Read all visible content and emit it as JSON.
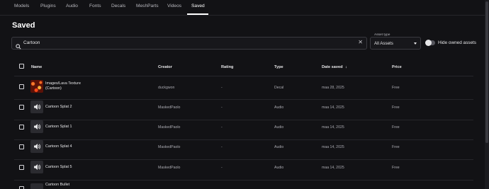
{
  "tabs": [
    {
      "label": "Models"
    },
    {
      "label": "Plugins"
    },
    {
      "label": "Audio"
    },
    {
      "label": "Fonts"
    },
    {
      "label": "Decals"
    },
    {
      "label": "MeshParts"
    },
    {
      "label": "Videos"
    },
    {
      "label": "Saved",
      "active": true
    }
  ],
  "page_title": "Saved",
  "search": {
    "value": "Cartoon"
  },
  "asset_type": {
    "label": "Asset type",
    "selected": "All Assets"
  },
  "hide_owned": {
    "label": "Hide owned assets",
    "on": false
  },
  "table": {
    "headers": {
      "name": "Name",
      "creator": "Creator",
      "rating": "Rating",
      "type": "Type",
      "date_saved": "Date saved",
      "price": "Price"
    },
    "sort_indicator": "↓",
    "rows": [
      {
        "name_line1": "Images/Lava Texture",
        "name_line2": "(Cartoon)",
        "creator": "duckgwon",
        "rating": "-",
        "type": "Decal",
        "date": "maa 28, 2025",
        "price": "Free",
        "thumb": "lava-texture-thumbnail"
      },
      {
        "name_line1": "Cartoon Splat 2",
        "name_line2": "",
        "creator": "MaskedPaolo",
        "rating": "-",
        "type": "Audio",
        "date": "maa 14, 2025",
        "price": "Free",
        "thumb": "speaker-icon"
      },
      {
        "name_line1": "Cartoon Splat 1",
        "name_line2": "",
        "creator": "MaskedPaolo",
        "rating": "-",
        "type": "Audio",
        "date": "maa 14, 2025",
        "price": "Free",
        "thumb": "speaker-icon"
      },
      {
        "name_line1": "Cartoon Splat 4",
        "name_line2": "",
        "creator": "MaskedPaolo",
        "rating": "-",
        "type": "Audio",
        "date": "maa 14, 2025",
        "price": "Free",
        "thumb": "speaker-icon"
      },
      {
        "name_line1": "Cartoon Splat 5",
        "name_line2": "",
        "creator": "MaskedPaolo",
        "rating": "-",
        "type": "Audio",
        "date": "maa 14, 2025",
        "price": "Free",
        "thumb": "speaker-icon"
      },
      {
        "name_line1": "Cartoon Bullet",
        "name_line2": "",
        "creator": "",
        "rating": "",
        "type": "",
        "date": "",
        "price": "",
        "thumb": "speaker-icon"
      }
    ]
  },
  "colors": {
    "background": "#121215",
    "text": "#e6e6e8",
    "muted": "#a9a9b0",
    "divider": "#26262b"
  }
}
